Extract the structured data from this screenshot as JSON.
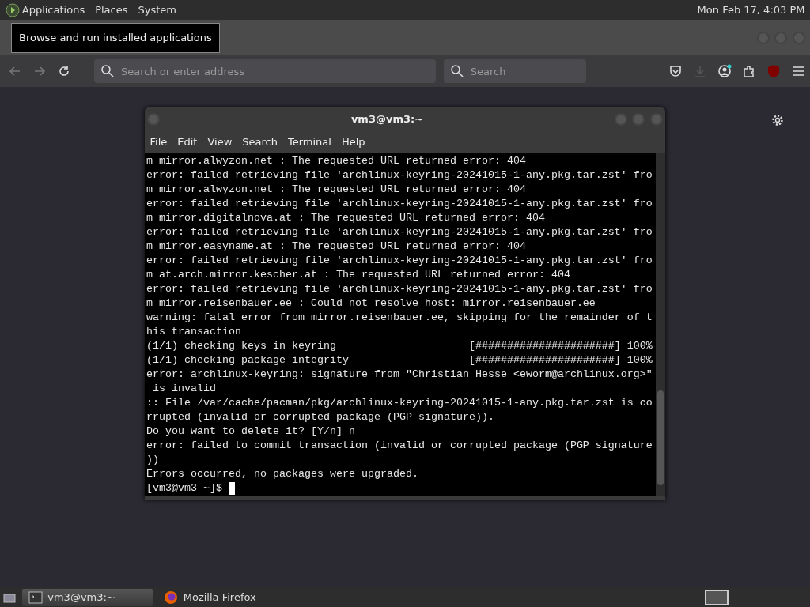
{
  "top_panel": {
    "menus": [
      "Applications",
      "Places",
      "System"
    ],
    "clock": "Mon Feb 17,  4:03 PM"
  },
  "tooltip": "Browse and run installed applications",
  "browser": {
    "address_placeholder": "Search or enter address",
    "search_placeholder": "Search"
  },
  "terminal": {
    "title": "vm3@vm3:~",
    "menu": [
      "File",
      "Edit",
      "View",
      "Search",
      "Terminal",
      "Help"
    ],
    "lines": [
      "m mirror.alwyzon.net : The requested URL returned error: 404",
      "error: failed retrieving file 'archlinux-keyring-20241015-1-any.pkg.tar.zst' fro",
      "m mirror.alwyzon.net : The requested URL returned error: 404",
      "error: failed retrieving file 'archlinux-keyring-20241015-1-any.pkg.tar.zst' fro",
      "m mirror.digitalnova.at : The requested URL returned error: 404",
      "error: failed retrieving file 'archlinux-keyring-20241015-1-any.pkg.tar.zst' fro",
      "m mirror.easyname.at : The requested URL returned error: 404",
      "error: failed retrieving file 'archlinux-keyring-20241015-1-any.pkg.tar.zst' fro",
      "m at.arch.mirror.kescher.at : The requested URL returned error: 404",
      "error: failed retrieving file 'archlinux-keyring-20241015-1-any.pkg.tar.zst' fro",
      "m mirror.reisenbauer.ee : Could not resolve host: mirror.reisenbauer.ee",
      "warning: fatal error from mirror.reisenbauer.ee, skipping for the remainder of t",
      "his transaction",
      "(1/1) checking keys in keyring                     [######################] 100%",
      "(1/1) checking package integrity                   [######################] 100%",
      "error: archlinux-keyring: signature from \"Christian Hesse <eworm@archlinux.org>\"",
      " is invalid",
      ":: File /var/cache/pacman/pkg/archlinux-keyring-20241015-1-any.pkg.tar.zst is co",
      "rrupted (invalid or corrupted package (PGP signature)).",
      "Do you want to delete it? [Y/n] n",
      "error: failed to commit transaction (invalid or corrupted package (PGP signature",
      "))",
      "Errors occurred, no packages were upgraded."
    ],
    "prompt": "[vm3@vm3 ~]$"
  },
  "taskbar": [
    {
      "label": "vm3@vm3:~",
      "selected": true
    },
    {
      "label": "Mozilla Firefox",
      "selected": false
    }
  ]
}
